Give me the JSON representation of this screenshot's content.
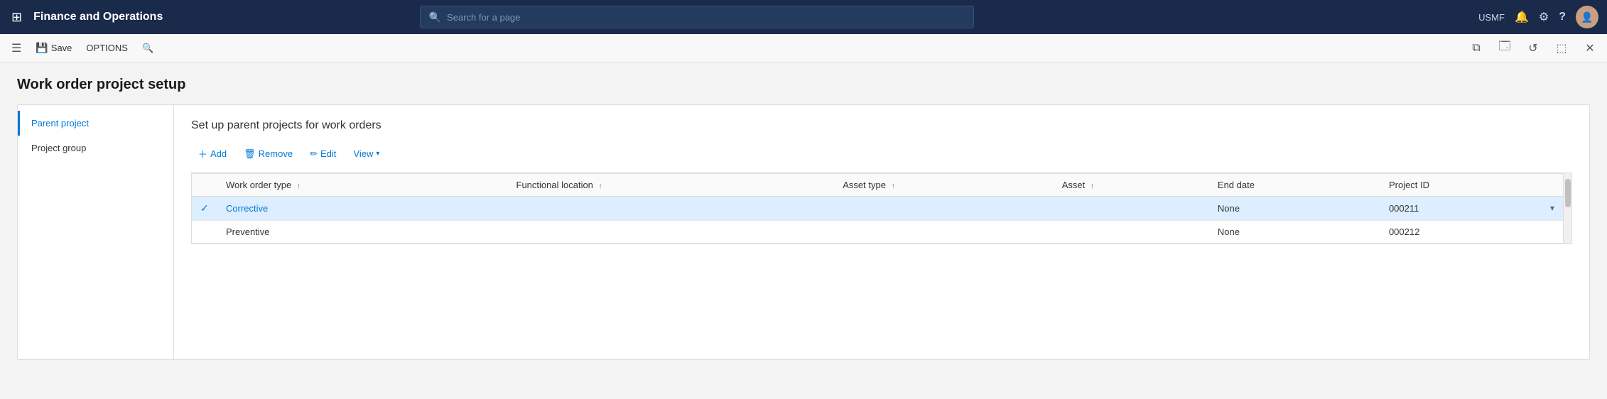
{
  "topNav": {
    "title": "Finance and Operations",
    "searchPlaceholder": "Search for a page",
    "userLabel": "USMF",
    "gridIcon": "⊞",
    "bellIcon": "🔔",
    "gearIcon": "⚙",
    "helpIcon": "?"
  },
  "commandBar": {
    "saveLabel": "Save",
    "optionsLabel": "OPTIONS",
    "searchIcon": "🔍",
    "rightIcons": [
      "⧉",
      "☐",
      "↺",
      "⬚",
      "✕"
    ]
  },
  "page": {
    "title": "Work order project setup",
    "sectionTitle": "Set up parent projects for work orders"
  },
  "leftNav": {
    "items": [
      {
        "label": "Parent project",
        "active": true
      },
      {
        "label": "Project group",
        "active": false
      }
    ]
  },
  "toolbar": {
    "addLabel": "Add",
    "removeLabel": "Remove",
    "editLabel": "Edit",
    "viewLabel": "View"
  },
  "table": {
    "columns": [
      {
        "label": ""
      },
      {
        "label": "Work order type",
        "sort": "↑"
      },
      {
        "label": "Functional location",
        "sort": "↑"
      },
      {
        "label": "Asset type",
        "sort": "↑"
      },
      {
        "label": "Asset",
        "sort": "↑"
      },
      {
        "label": "End date",
        "sort": ""
      },
      {
        "label": "Project ID",
        "sort": ""
      }
    ],
    "rows": [
      {
        "selected": true,
        "checkmark": "✓",
        "workOrderType": "Corrective",
        "functionalLocation": "",
        "assetType": "",
        "asset": "",
        "endDate": "None",
        "projectId": "000211",
        "hasDropdown": true
      },
      {
        "selected": false,
        "checkmark": "",
        "workOrderType": "Preventive",
        "functionalLocation": "",
        "assetType": "",
        "asset": "",
        "endDate": "None",
        "projectId": "000212",
        "hasDropdown": false
      }
    ]
  }
}
